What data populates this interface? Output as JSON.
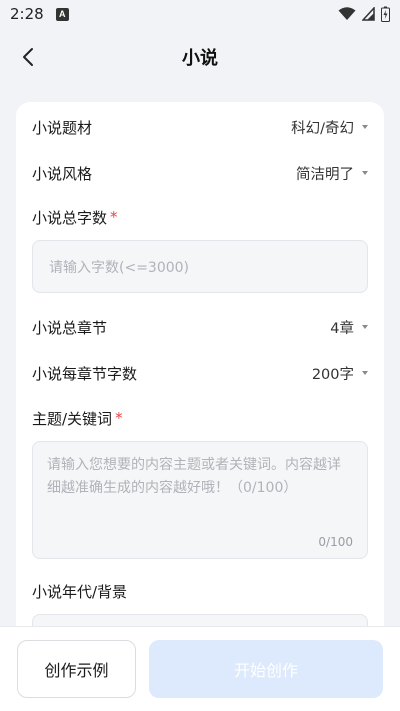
{
  "status_bar": {
    "time": "2:28",
    "notification": "A"
  },
  "header": {
    "title": "小说"
  },
  "form": {
    "genre": {
      "label": "小说题材",
      "value": "科幻/奇幻"
    },
    "style": {
      "label": "小说风格",
      "value": "简洁明了"
    },
    "total_words": {
      "label": "小说总字数",
      "required_mark": "*",
      "placeholder": "请输入字数(<=3000)"
    },
    "total_chapters": {
      "label": "小说总章节",
      "value": "4章"
    },
    "words_per_chapter": {
      "label": "小说每章节字数",
      "value": "200字"
    },
    "keywords": {
      "label": "主题/关键词",
      "required_mark": "*",
      "placeholder": "请输入您想要的内容主题或者关键词。内容越详细越准确生成的内容越好哦！（0/100）",
      "counter": "0/100"
    },
    "era": {
      "label": "小说年代/背景"
    }
  },
  "actions": {
    "example_label": "创作示例",
    "start_label": "开始创作"
  },
  "colors": {
    "accent_disabled": "#dde9fc",
    "required": "#e54545"
  }
}
